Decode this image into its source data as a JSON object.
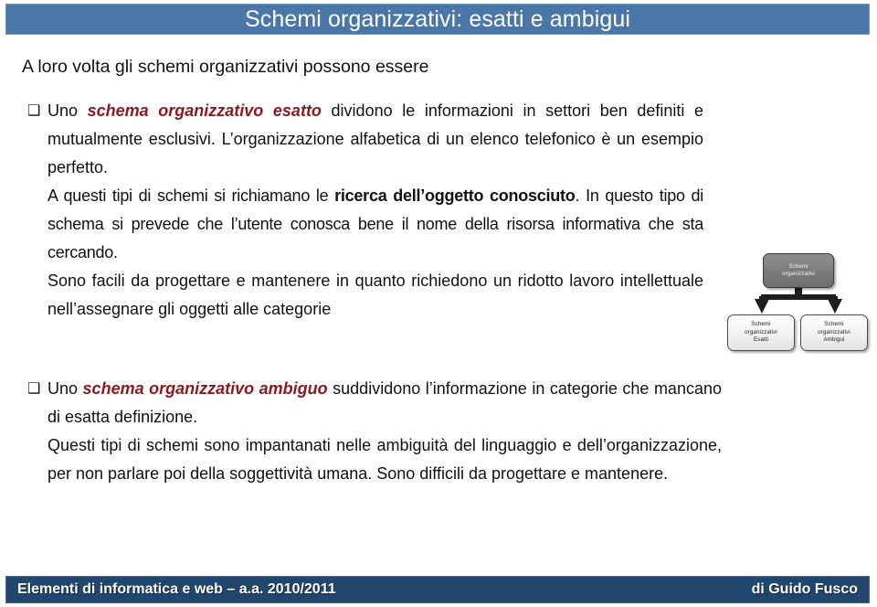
{
  "slide": {
    "title": "Schemi organizzativi: esatti e ambigui",
    "title_bar_color": "#4A76A8",
    "footer_bar_color": "#21476E",
    "accent_red": "#8C1A21"
  },
  "lead_line": "A loro volta gli schemi organizzativi possono essere",
  "bullets": [
    {
      "marker": "❑",
      "paragraphs": [
        {
          "id": "esatto-p1",
          "lead": "Uno ",
          "emphasis": "schema organizzativo esatto",
          "rest": " dividono le informazioni in settori ben definiti e mutualmente esclusivi. L’organizzazione alfabetica di un elenco telefonico è un esempio perfetto."
        },
        {
          "id": "esatto-p2",
          "lead": "A questi tipi di schemi si richiamano le ",
          "emphasis": "ricerca dell’oggetto conosciuto",
          "rest": ". In questo tipo di schema si prevede che l’utente conosca bene il nome della risorsa informativa che sta cercando."
        },
        {
          "id": "esatto-p3",
          "lead": "Sono facili da progettare e mantenere in quanto richiedono un ridotto lavoro intellettuale nell’assegnare gli oggetti alle categorie",
          "emphasis": "",
          "rest": ""
        }
      ]
    },
    {
      "marker": "❑",
      "paragraphs": [
        {
          "id": "ambiguo-p1",
          "lead": "Uno ",
          "emphasis": "schema organizzativo ambiguo",
          "rest": " suddividono l’informazione in categorie che mancano di esatta definizione."
        },
        {
          "id": "ambiguo-p2",
          "lead": "Questi tipi di schemi sono impantanati nelle ambiguità del linguaggio e dell’organizzazione, per non parlare poi della soggettività umana. Sono difficili da progettare e mantenere.",
          "emphasis": "",
          "rest": ""
        }
      ]
    }
  ],
  "diagram": {
    "type": "hierarchy",
    "root": {
      "line1": "Schemi",
      "line2": "organizzativi",
      "line3": ""
    },
    "children": [
      {
        "line1": "Schemi",
        "line2": "organizzativi",
        "line3": "Esatti"
      },
      {
        "line1": "Schemi",
        "line2": "organizzativi",
        "line3": "Ambigui"
      }
    ]
  },
  "footer": {
    "left": "Elementi di informatica e web – a.a. 2010/2011",
    "right": "di Guido Fusco"
  }
}
